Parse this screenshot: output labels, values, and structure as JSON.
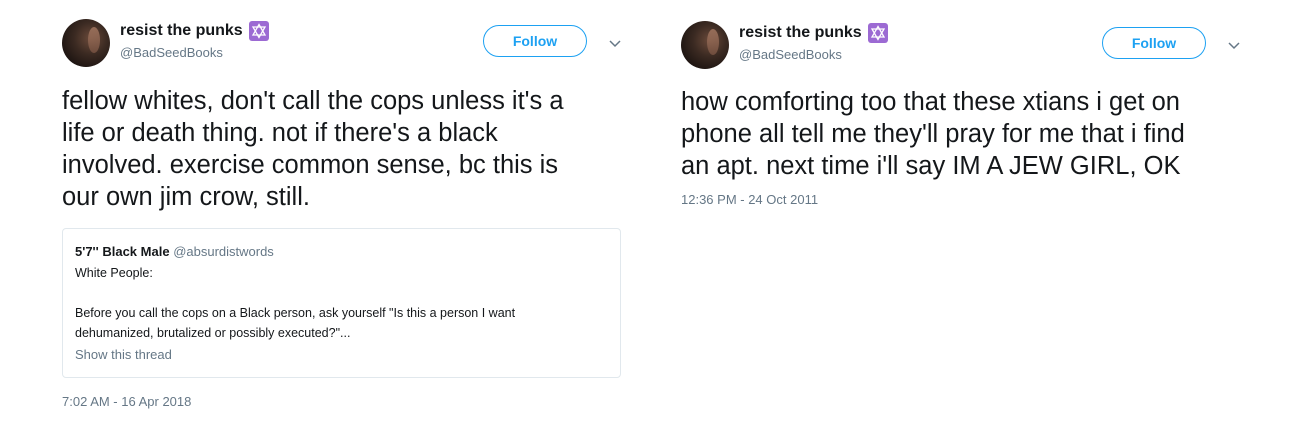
{
  "tweets": [
    {
      "author": {
        "display_name": "resist the punks",
        "handle": "@BadSeedBooks",
        "badge_icon": "star-of-david-icon",
        "badge_color": "#9c6ad3"
      },
      "follow_label": "Follow",
      "text_lines": [
        "fellow whites, don't call the cops unless it's a",
        "life or death thing. not if there's a black",
        "involved. exercise common sense, bc this is",
        "our own jim crow, still."
      ],
      "quoted_tweet": {
        "display_name": "5'7'' Black Male",
        "handle": "@absurdistwords",
        "line_1": "White People:",
        "line_2": "Before you call the cops on a Black person, ask yourself \"Is this a person I want",
        "line_3": "dehumanized, brutalized or possibly executed?\"...",
        "show_thread": "Show this thread"
      },
      "timestamp": "7:02 AM - 16 Apr 2018"
    },
    {
      "author": {
        "display_name": "resist the punks",
        "handle": "@BadSeedBooks",
        "badge_icon": "star-of-david-icon",
        "badge_color": "#9c6ad3"
      },
      "follow_label": "Follow",
      "text_lines": [
        "how comforting too that these xtians i get on",
        "phone all tell me they'll pray for me that i find",
        "an apt. next time i'll say IM A JEW GIRL, OK"
      ],
      "timestamp": "12:36 PM - 24 Oct 2011"
    }
  ],
  "colors": {
    "accent": "#1da1f2",
    "secondary_text": "#657786",
    "primary_text": "#14171a",
    "border": "#e1e8ed"
  }
}
